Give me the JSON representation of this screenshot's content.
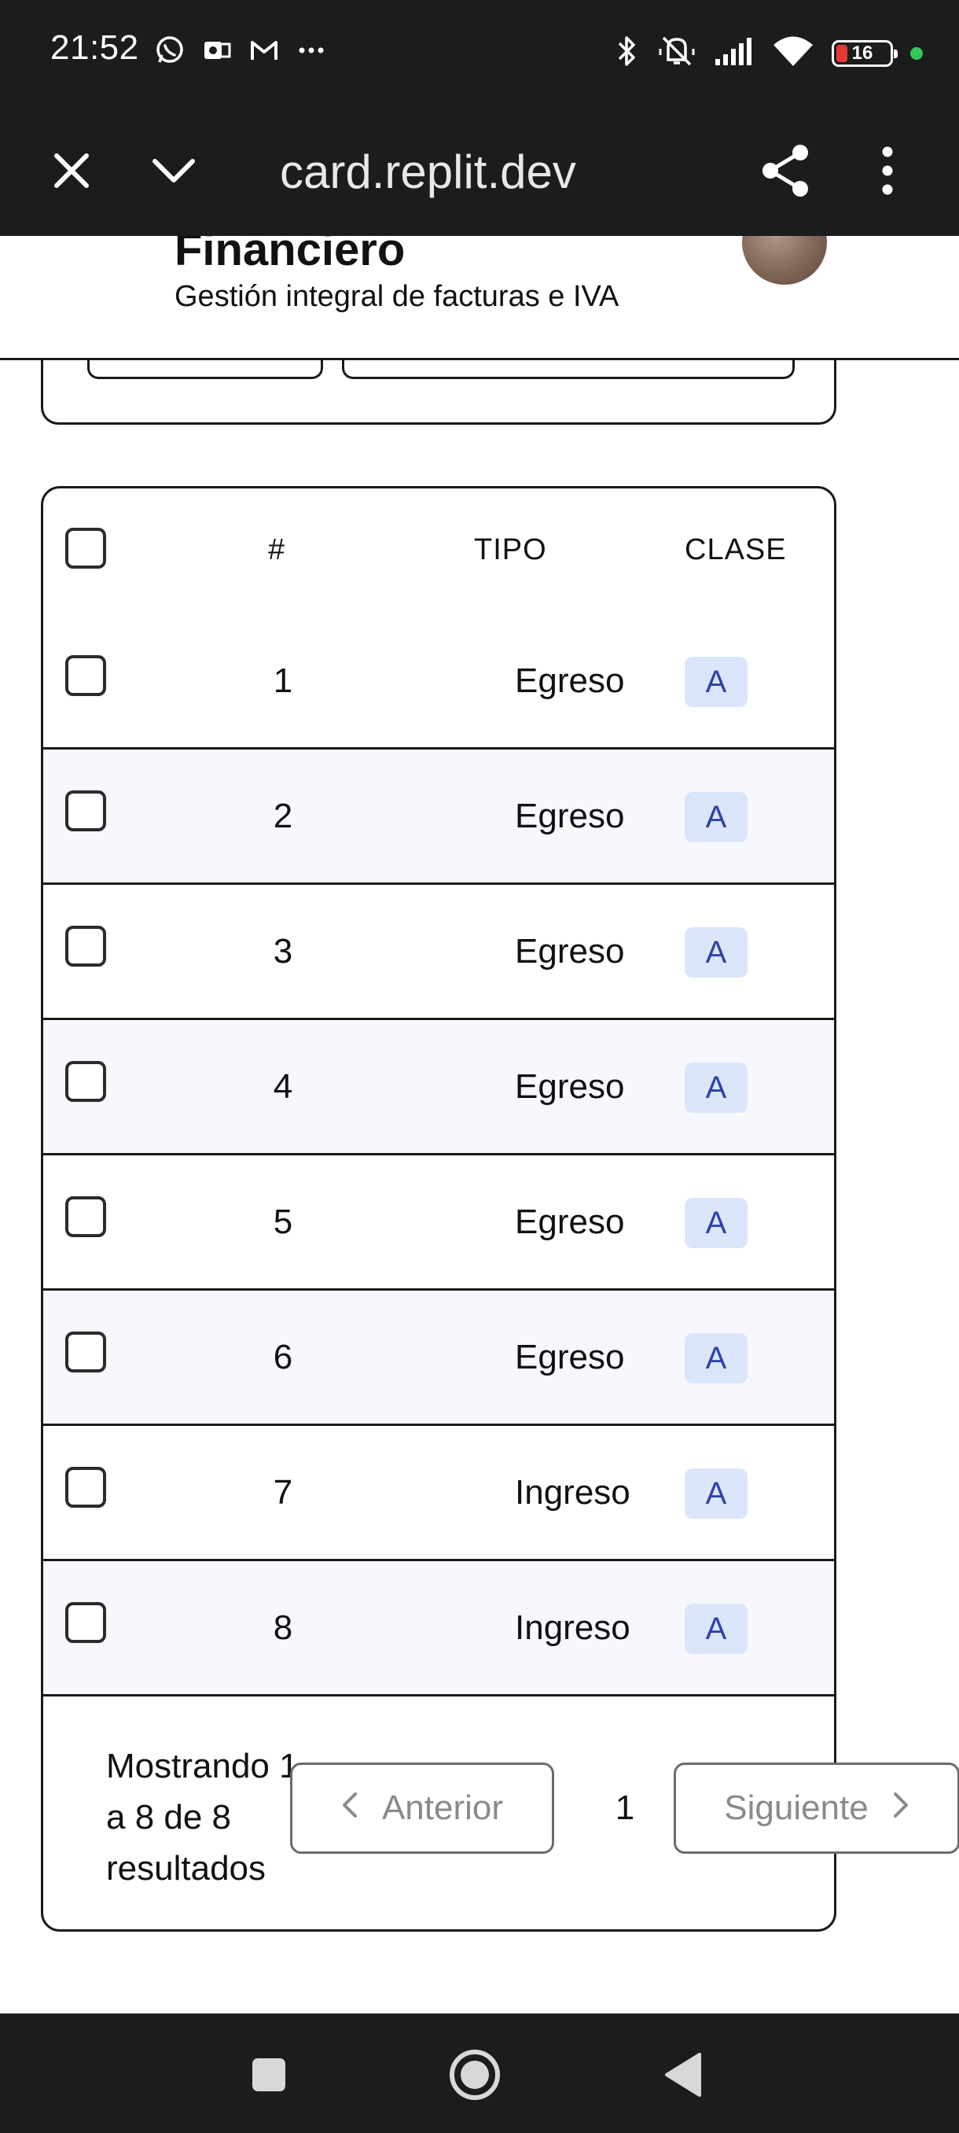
{
  "status_bar": {
    "time": "21:52",
    "battery_level": "16",
    "left_icons": [
      "whatsapp-icon",
      "outlook-icon",
      "gmail-icon",
      "more-dots-icon"
    ],
    "right_icons": [
      "bluetooth-icon",
      "vibrate-off-icon",
      "signal-icon",
      "wifi-icon",
      "battery-icon"
    ],
    "colors": {
      "battery_low": "#e53935",
      "active_dot": "#34c759"
    }
  },
  "browser": {
    "url": "card.replit.dev",
    "icons": [
      "close-icon",
      "chevron-down-icon",
      "share-icon",
      "more-vert-icon"
    ]
  },
  "header": {
    "title": "Financiero",
    "subtitle": "Gestión integral de facturas e IVA"
  },
  "table": {
    "columns": [
      "#",
      "TIPO",
      "CLASE"
    ],
    "rows": [
      {
        "num": "1",
        "tipo": "Egreso",
        "clase": "A"
      },
      {
        "num": "2",
        "tipo": "Egreso",
        "clase": "A"
      },
      {
        "num": "3",
        "tipo": "Egreso",
        "clase": "A"
      },
      {
        "num": "4",
        "tipo": "Egreso",
        "clase": "A"
      },
      {
        "num": "5",
        "tipo": "Egreso",
        "clase": "A"
      },
      {
        "num": "6",
        "tipo": "Egreso",
        "clase": "A"
      },
      {
        "num": "7",
        "tipo": "Ingreso",
        "clase": "A"
      },
      {
        "num": "8",
        "tipo": "Ingreso",
        "clase": "A"
      }
    ],
    "colors": {
      "badge_bg": "#dbe6fb",
      "badge_text": "#2f43a8",
      "alt_row_bg": "#f6f8fd"
    }
  },
  "pagination": {
    "showing_text": "Mostrando 1 a 8 de 8 resultados",
    "prev_label": "Anterior",
    "current_page": "1",
    "next_label": "Siguiente"
  },
  "nav_bar": {
    "icons": [
      "recents-square-icon",
      "home-circle-icon",
      "back-triangle-icon"
    ]
  }
}
